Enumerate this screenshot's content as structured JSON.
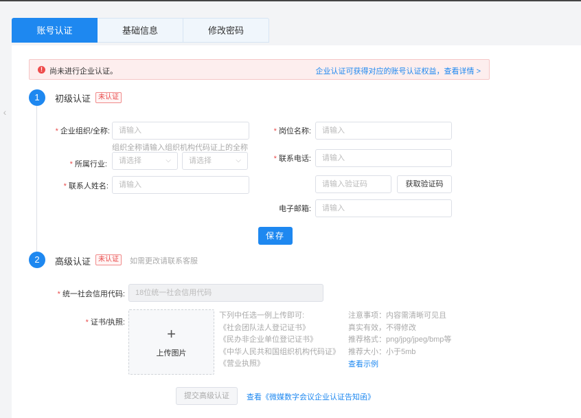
{
  "tabs": [
    {
      "label": "账号认证",
      "active": true
    },
    {
      "label": "基础信息",
      "active": false
    },
    {
      "label": "修改密码",
      "active": false
    }
  ],
  "alert": {
    "icon": "exclamation-icon",
    "text": "尚未进行企业认证。",
    "link": "企业认证可获得对应的账号认证权益，查看详情 >"
  },
  "step1": {
    "number": "1",
    "title": "初级认证",
    "badge": "未认证",
    "fields": {
      "org_name_label": "企业组织/全称:",
      "org_name_placeholder": "请输入",
      "org_name_hint": "组织全称请输入组织机构代码证上的全称",
      "industry_label": "所属行业:",
      "industry_select1": "请选择",
      "industry_select2": "请选择",
      "contact_label": "联系人姓名:",
      "contact_placeholder": "请输入",
      "position_label": "岗位名称:",
      "position_placeholder": "请输入",
      "phone_label": "联系电话:",
      "phone_placeholder": "请输入",
      "code_placeholder": "请输入验证码",
      "get_code_button": "获取验证码",
      "email_label": "电子邮箱:",
      "email_placeholder": "请输入"
    },
    "save_button": "保存"
  },
  "step2": {
    "number": "2",
    "title": "高级认证",
    "badge": "未认证",
    "hint": "如需更改请联系客服",
    "credit_code_label": "统一社会信用代码:",
    "credit_code_placeholder": "18位统一社会信用代码",
    "cert_label": "证书/执照:",
    "upload_text": "上传图片",
    "docs": [
      "下列中任选一例上传即可:",
      "《社会团队法人登记证书》",
      "《民办非企业单位登记证书》",
      "《中华人民共和国组织机构代码证》",
      "《营业执照》"
    ],
    "notes": [
      "注意事项：内容需清晰可见且",
      "真实有效，不得修改",
      "推荐格式：png/jpg/jpeg/bmp等",
      "推荐大小：小于5mb"
    ],
    "example_link": "查看示例",
    "submit_button": "提交高级认证",
    "notice_link": "查看《微媒数字会议企业认证告知函》"
  },
  "colors": {
    "primary": "#1e88f0",
    "danger": "#e84a4a",
    "alert_bg": "#fdeeee"
  }
}
